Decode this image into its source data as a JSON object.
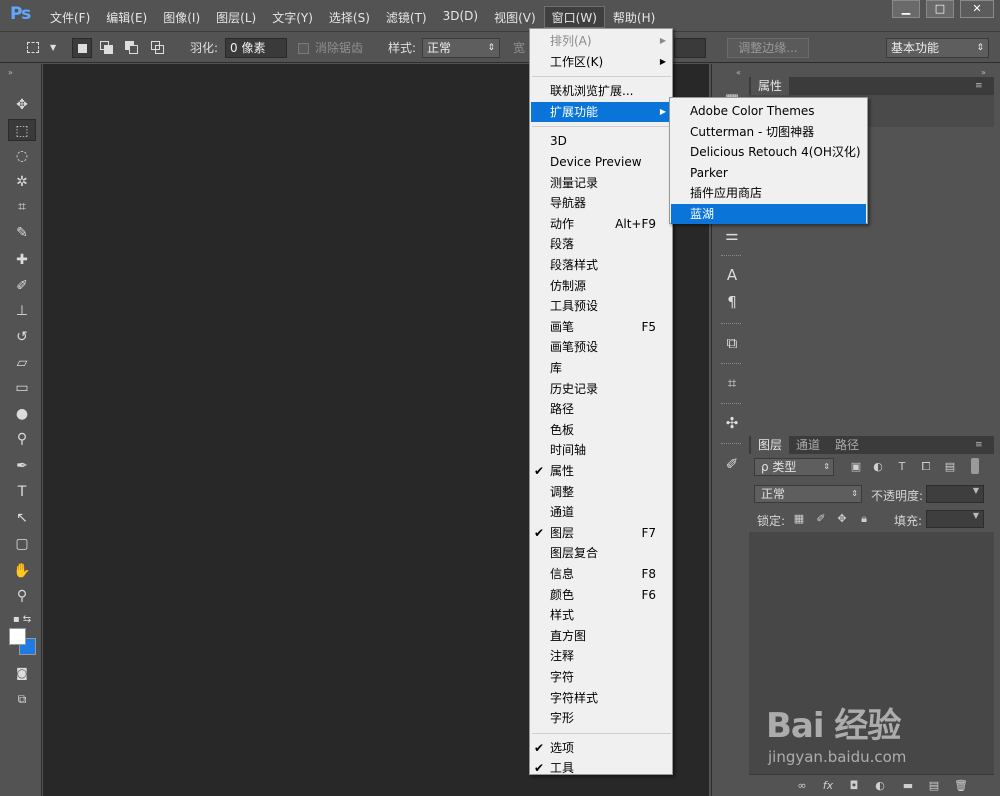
{
  "app": {
    "logo": "Ps"
  },
  "menubar": {
    "items": [
      {
        "label": "文件(F)"
      },
      {
        "label": "编辑(E)"
      },
      {
        "label": "图像(I)"
      },
      {
        "label": "图层(L)"
      },
      {
        "label": "文字(Y)"
      },
      {
        "label": "选择(S)"
      },
      {
        "label": "滤镜(T)"
      },
      {
        "label": "3D(D)"
      },
      {
        "label": "视图(V)"
      },
      {
        "label": "窗口(W)"
      },
      {
        "label": "帮助(H)"
      }
    ],
    "active_index": 9,
    "window_controls": {
      "minimize": "▁",
      "maximize": "□",
      "close": "✕"
    }
  },
  "optionsbar": {
    "feather_label": "羽化:",
    "feather_value": "0 像素",
    "antialias_label": "消除锯齿",
    "style_label": "样式:",
    "style_value": "正常",
    "width_label": "宽",
    "refine_edge": "调整边缘...",
    "workspace": "基本功能"
  },
  "window_menu": {
    "items": [
      {
        "label": "排列(A)",
        "disabled": true,
        "submenu": true
      },
      {
        "label": "工作区(K)",
        "submenu": true
      },
      {
        "sep": true
      },
      {
        "label": "联机浏览扩展..."
      },
      {
        "label": "扩展功能",
        "submenu": true,
        "highlighted": true
      },
      {
        "sep": true
      },
      {
        "label": "3D"
      },
      {
        "label": "Device Preview"
      },
      {
        "label": "测量记录"
      },
      {
        "label": "导航器"
      },
      {
        "label": "动作",
        "shortcut": "Alt+F9"
      },
      {
        "label": "段落"
      },
      {
        "label": "段落样式"
      },
      {
        "label": "仿制源"
      },
      {
        "label": "工具预设"
      },
      {
        "label": "画笔",
        "shortcut": "F5"
      },
      {
        "label": "画笔预设"
      },
      {
        "label": "库"
      },
      {
        "label": "历史记录"
      },
      {
        "label": "路径"
      },
      {
        "label": "色板"
      },
      {
        "label": "时间轴"
      },
      {
        "label": "属性",
        "checked": true
      },
      {
        "label": "调整"
      },
      {
        "label": "通道"
      },
      {
        "label": "图层",
        "checked": true,
        "shortcut": "F7"
      },
      {
        "label": "图层复合"
      },
      {
        "label": "信息",
        "shortcut": "F8"
      },
      {
        "label": "颜色",
        "shortcut": "F6"
      },
      {
        "label": "样式"
      },
      {
        "label": "直方图"
      },
      {
        "label": "注释"
      },
      {
        "label": "字符"
      },
      {
        "label": "字符样式"
      },
      {
        "label": "字形"
      },
      {
        "sep": true
      },
      {
        "label": "选项",
        "checked": true
      },
      {
        "label": "工具",
        "checked": true
      }
    ]
  },
  "extensions_submenu": {
    "items": [
      {
        "label": "Adobe Color Themes"
      },
      {
        "label": "Cutterman - 切图神器"
      },
      {
        "label": "Delicious Retouch 4(OH汉化)"
      },
      {
        "label": "Parker"
      },
      {
        "label": "插件应用商店"
      },
      {
        "label": "蓝湖",
        "highlighted": true
      }
    ]
  },
  "properties_panel": {
    "tab": "属性"
  },
  "layers_panel": {
    "tabs": [
      "图层",
      "通道",
      "路径"
    ],
    "filter_label": "ρ 类型",
    "blend_mode": "正常",
    "opacity_label": "不透明度:",
    "lock_label": "锁定:",
    "fill_label": "填充:"
  },
  "watermark": {
    "brand": "Bai 经验",
    "url": "jingyan.baidu.com"
  },
  "colors": {
    "accent": "#0a74d8",
    "canvas": "#282828",
    "ui": "#535353"
  }
}
